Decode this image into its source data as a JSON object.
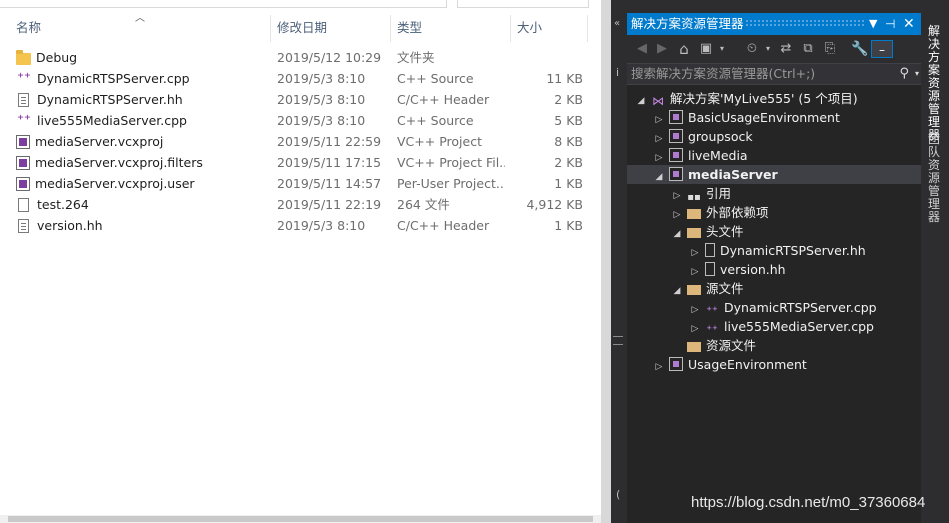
{
  "explorer": {
    "columns": {
      "name": "名称",
      "date": "修改日期",
      "type": "类型",
      "size": "大小"
    },
    "files": [
      {
        "icon": "folder-icon",
        "name": "Debug",
        "date": "2019/5/12 10:29",
        "type": "文件夹",
        "size": ""
      },
      {
        "icon": "cpp-file-icon",
        "name": "DynamicRTSPServer.cpp",
        "date": "2019/5/3 8:10",
        "type": "C++ Source",
        "size": "11 KB"
      },
      {
        "icon": "header-file-icon",
        "name": "DynamicRTSPServer.hh",
        "date": "2019/5/3 8:10",
        "type": "C/C++ Header",
        "size": "2 KB"
      },
      {
        "icon": "cpp-file-icon",
        "name": "live555MediaServer.cpp",
        "date": "2019/5/3 8:10",
        "type": "C++ Source",
        "size": "5 KB"
      },
      {
        "icon": "vcxproj-file-icon",
        "name": "mediaServer.vcxproj",
        "date": "2019/5/11 22:59",
        "type": "VC++ Project",
        "size": "8 KB"
      },
      {
        "icon": "filters-file-icon",
        "name": "mediaServer.vcxproj.filters",
        "date": "2019/5/11 17:15",
        "type": "VC++ Project Fil...",
        "size": "2 KB"
      },
      {
        "icon": "user-file-icon",
        "name": "mediaServer.vcxproj.user",
        "date": "2019/5/11 14:57",
        "type": "Per-User Project...",
        "size": "1 KB"
      },
      {
        "icon": "file-icon",
        "name": "test.264",
        "date": "2019/5/11 22:19",
        "type": "264 文件",
        "size": "4,912 KB"
      },
      {
        "icon": "header-file-icon",
        "name": "version.hh",
        "date": "2019/5/3 8:10",
        "type": "C/C++ Header",
        "size": "1 KB"
      }
    ]
  },
  "solution_explorer": {
    "title": "解决方案资源管理器",
    "search_placeholder": "搜索解决方案资源管理器(Ctrl+;)",
    "tree": [
      {
        "label": "解决方案'MyLive555' (5 个项目)",
        "icon": "solution-icon",
        "level": 0,
        "twisty": "expanded",
        "selected": false
      },
      {
        "label": "BasicUsageEnvironment",
        "icon": "project-icon",
        "level": 1,
        "twisty": "collapsed",
        "selected": false
      },
      {
        "label": "groupsock",
        "icon": "project-icon",
        "level": 1,
        "twisty": "collapsed",
        "selected": false
      },
      {
        "label": "liveMedia",
        "icon": "project-icon",
        "level": 1,
        "twisty": "collapsed",
        "selected": false
      },
      {
        "label": "mediaServer",
        "icon": "project-icon",
        "level": 1,
        "twisty": "expanded",
        "selected": true
      },
      {
        "label": "引用",
        "icon": "references-icon",
        "level": 2,
        "twisty": "collapsed",
        "selected": false
      },
      {
        "label": "外部依赖项",
        "icon": "external-deps-icon",
        "level": 2,
        "twisty": "collapsed",
        "selected": false
      },
      {
        "label": "头文件",
        "icon": "filter-folder-icon",
        "level": 2,
        "twisty": "expanded",
        "selected": false
      },
      {
        "label": "DynamicRTSPServer.hh",
        "icon": "header-file-icon",
        "level": 3,
        "twisty": "collapsed",
        "selected": false
      },
      {
        "label": "version.hh",
        "icon": "header-file-icon",
        "level": 3,
        "twisty": "collapsed",
        "selected": false
      },
      {
        "label": "源文件",
        "icon": "filter-folder-icon",
        "level": 2,
        "twisty": "expanded",
        "selected": false
      },
      {
        "label": "DynamicRTSPServer.cpp",
        "icon": "cpp-file-icon",
        "level": 3,
        "twisty": "collapsed",
        "selected": false
      },
      {
        "label": "live555MediaServer.cpp",
        "icon": "cpp-file-icon",
        "level": 3,
        "twisty": "collapsed",
        "selected": false
      },
      {
        "label": "资源文件",
        "icon": "filter-folder-icon",
        "level": 2,
        "twisty": "none",
        "selected": false
      },
      {
        "label": "UsageEnvironment",
        "icon": "project-icon",
        "level": 1,
        "twisty": "collapsed",
        "selected": false
      }
    ]
  },
  "side_tabs": [
    "解决方案资源管理器",
    "团队资源管理器"
  ],
  "watermark": "https://blog.csdn.net/m0_37360684",
  "colors": {
    "accent": "#007acc",
    "vs_bg": "#252526",
    "selected_row": "#3f3f46"
  }
}
